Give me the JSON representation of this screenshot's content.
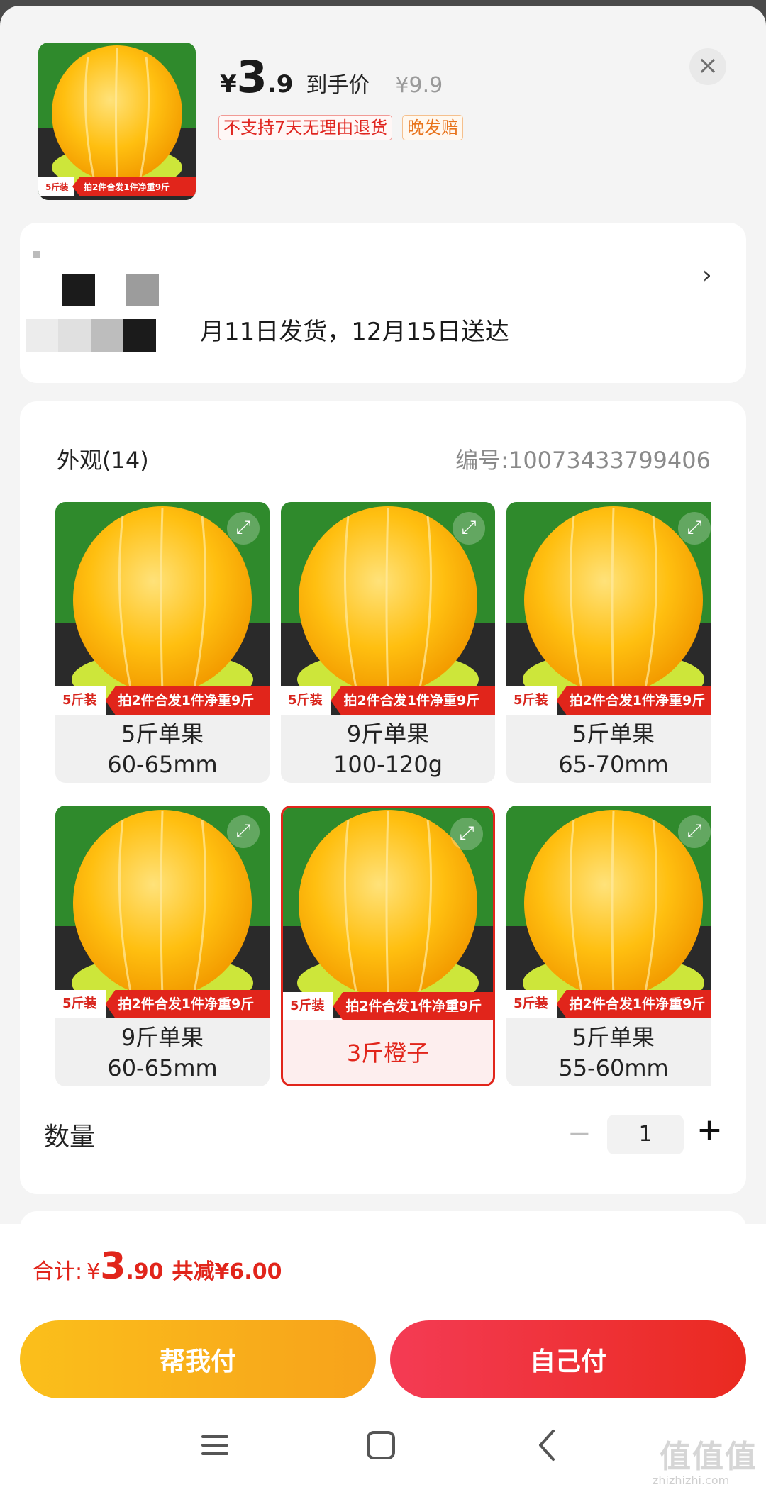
{
  "product": {
    "price_currency": "¥",
    "price_int": "3",
    "price_dec": ".9",
    "price_label": "到手价",
    "original_price": "¥9.9",
    "tag_no_return": "不支持7天无理由退货",
    "tag_late_ship": "晚发赔",
    "thumb_badge_left": "5斤装",
    "thumb_badge_right": "拍2件合发1件净重9斤"
  },
  "address": {
    "delivery_text": "月11日发货，12月15日送达"
  },
  "options": {
    "title": "外观(14)",
    "code": "编号:10073433799406",
    "badge_left": "5斤装",
    "badge_right": "拍2件合发1件净重9斤",
    "items": [
      {
        "line1": "5斤单果",
        "line2": "60-65mm"
      },
      {
        "line1": "9斤单果",
        "line2": "100-120g"
      },
      {
        "line1": "5斤单果",
        "line2": "65-70mm"
      },
      {
        "line1": "9斤单果",
        "line2": "60-65mm"
      },
      {
        "line1": "3斤橙子",
        "line2": ""
      },
      {
        "line1": "5斤单果",
        "line2": "55-60mm"
      }
    ],
    "selected_index": 4
  },
  "quantity": {
    "label": "数量",
    "value": "1",
    "minus": "−",
    "plus": "+"
  },
  "footer": {
    "total_label": "合计:",
    "total_currency": "¥",
    "total_int": "3",
    "total_dec": ".90",
    "savings": "共减¥6.00",
    "help_pay": "帮我付",
    "self_pay": "自己付"
  },
  "watermark": {
    "text": "值值值",
    "sub": "zhizhizhi.com"
  },
  "colors": {
    "accent_red": "#e1251b",
    "help_orange": "#f9b21b"
  }
}
